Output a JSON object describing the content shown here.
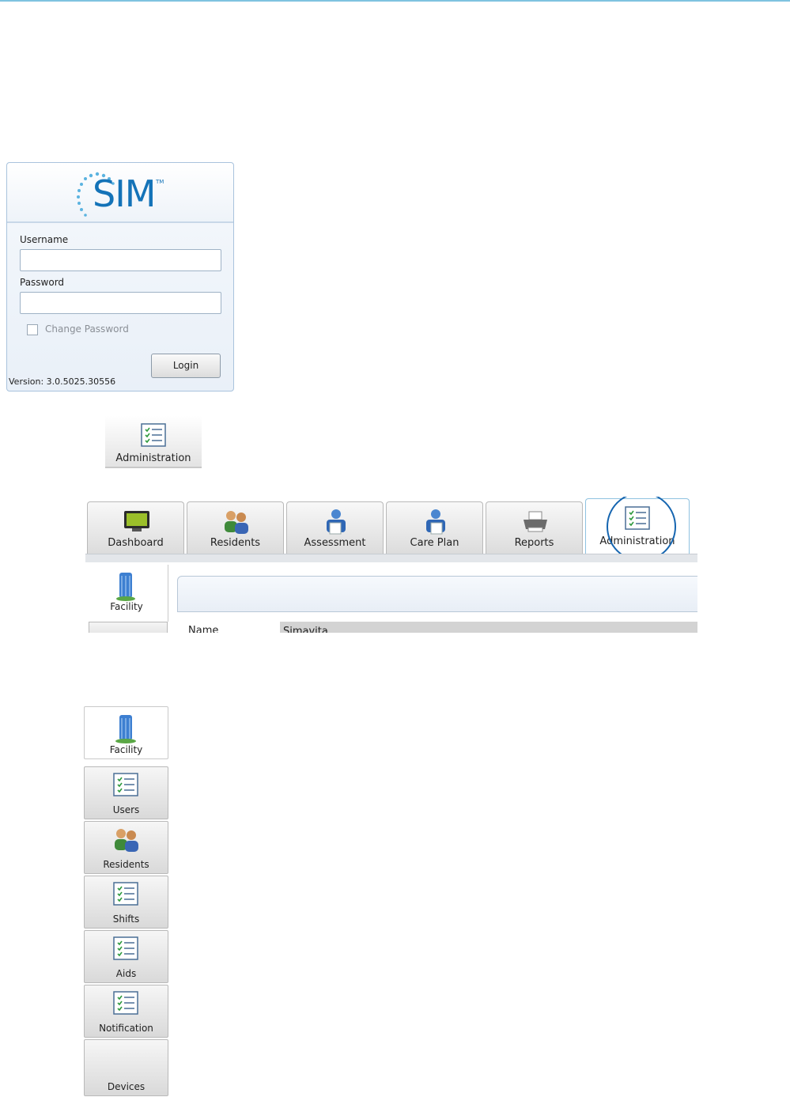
{
  "login": {
    "logo_text": "SIM",
    "logo_tm": "TM",
    "username_label": "Username",
    "username_value": "",
    "password_label": "Password",
    "password_value": "",
    "change_password_label": "Change Password",
    "login_button": "Login",
    "version": "Version: 3.0.5025.30556"
  },
  "admin_button": {
    "label": "Administration",
    "icon": "checklist-icon"
  },
  "tabs": [
    {
      "label": "Dashboard",
      "icon": "monitor-icon"
    },
    {
      "label": "Residents",
      "icon": "people-icon"
    },
    {
      "label": "Assessment",
      "icon": "assessment-icon"
    },
    {
      "label": "Care Plan",
      "icon": "care-plan-icon"
    },
    {
      "label": "Reports",
      "icon": "printer-icon"
    },
    {
      "label": "Administration",
      "icon": "checklist-icon",
      "active": true
    }
  ],
  "preview": {
    "facility_label": "Facility",
    "name_label": "Name",
    "name_value": "Simavita"
  },
  "sidebar": [
    {
      "label": "Facility",
      "icon": "building-icon",
      "active": true
    },
    {
      "label": "Users",
      "icon": "checklist-icon"
    },
    {
      "label": "Residents",
      "icon": "people-icon"
    },
    {
      "label": "Shifts",
      "icon": "checklist-icon"
    },
    {
      "label": "Aids",
      "icon": "checklist-icon"
    },
    {
      "label": "Notification",
      "icon": "checklist-icon"
    },
    {
      "label": "Devices",
      "icon": ""
    }
  ],
  "colors": {
    "accent": "#1473b8",
    "highlight_circle": "#1565b0",
    "active_tab_border": "#8fc2e0"
  }
}
